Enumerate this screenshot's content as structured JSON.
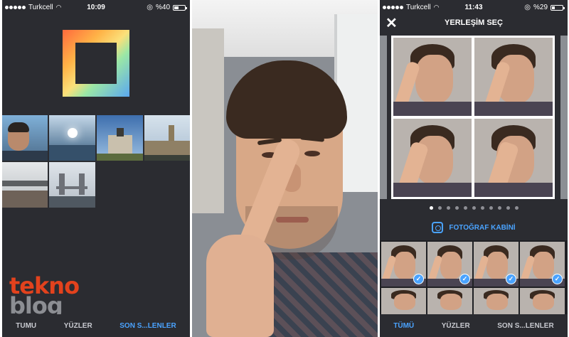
{
  "left_screen": {
    "status": {
      "carrier": "Turkcell",
      "time": "10:09",
      "battery": "%40",
      "battery_level": 0.4
    },
    "thumbnails": [
      {
        "name": "selfie-bridge"
      },
      {
        "name": "sun-over-river"
      },
      {
        "name": "wellington-arch"
      },
      {
        "name": "big-ben"
      },
      {
        "name": "thames-bridge"
      },
      {
        "name": "tower-bridge"
      }
    ],
    "tabs": [
      {
        "label": "TUMU",
        "active": false
      },
      {
        "label": "YÜZLER",
        "active": false
      },
      {
        "label": "SON S...LENLER",
        "active": true
      }
    ],
    "watermark": {
      "line1": "tekno",
      "line2": "blog"
    }
  },
  "right_screen": {
    "status": {
      "carrier": "Turkcell",
      "time": "11:43",
      "battery": "%29",
      "battery_level": 0.29
    },
    "title": "YERLEŞİM SEÇ",
    "pager": {
      "count": 11,
      "active": 0
    },
    "photobooth_label": "FOTOĞRAF KABİNİ",
    "tabs": [
      {
        "label": "TÜMÜ",
        "active": true
      },
      {
        "label": "YÜZLER",
        "active": false
      },
      {
        "label": "SON S...LENLER",
        "active": false
      }
    ]
  },
  "colors": {
    "accent": "#4aa3ff",
    "panel_bg": "#2b2c31",
    "watermark_red": "#e2421d",
    "watermark_grey": "#8c8e93"
  }
}
